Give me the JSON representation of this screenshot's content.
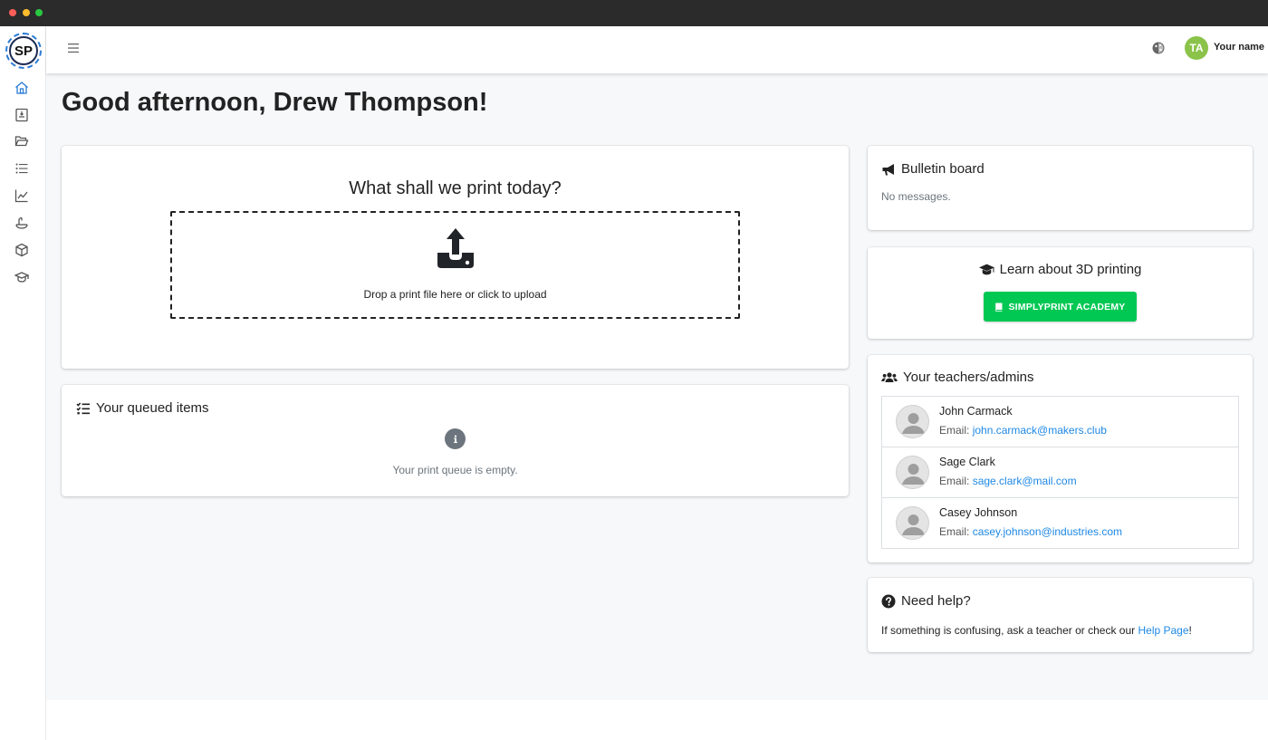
{
  "colors": {
    "accent": "#1e88e5",
    "academy_button": "#00c853",
    "avatar": "#8bc34a",
    "titlebar": "#2b2b2b"
  },
  "sidebar": {
    "logo_text": "SP",
    "items": [
      {
        "icon": "home-icon",
        "active": true
      },
      {
        "icon": "printer-icon"
      },
      {
        "icon": "folder-icon"
      },
      {
        "icon": "list-icon"
      },
      {
        "icon": "chart-icon"
      },
      {
        "icon": "filament-spool-icon"
      },
      {
        "icon": "cube-icon"
      },
      {
        "icon": "graduation-cap-icon"
      }
    ]
  },
  "topbar": {
    "menu_icon": "hamburger-icon",
    "theme_icon": "theme-toggle-icon",
    "user": {
      "initials": "TA",
      "name": "Your name"
    }
  },
  "greeting": "Good afternoon, Drew Thompson!",
  "upload": {
    "title": "What shall we print today?",
    "icon": "upload-icon",
    "dropzone_text": "Drop a print file here or click to upload"
  },
  "queue": {
    "title": "Your queued items",
    "empty_text": "Your print queue is empty."
  },
  "bulletin": {
    "title": "Bulletin board",
    "empty_text": "No messages."
  },
  "learn": {
    "title": "Learn about 3D printing",
    "button_label": "SIMPLYPRINT ACADEMY"
  },
  "teachers": {
    "title": "Your teachers/admins",
    "email_label": "Email:",
    "list": [
      {
        "name": "John Carmack",
        "email": "john.carmack@makers.club"
      },
      {
        "name": "Sage Clark",
        "email": "sage.clark@mail.com"
      },
      {
        "name": "Casey Johnson",
        "email": "casey.johnson@industries.com"
      }
    ]
  },
  "help": {
    "title": "Need help?",
    "text_before": "If something is confusing, ask a teacher or check our ",
    "link_label": "Help Page",
    "text_after": "!"
  }
}
